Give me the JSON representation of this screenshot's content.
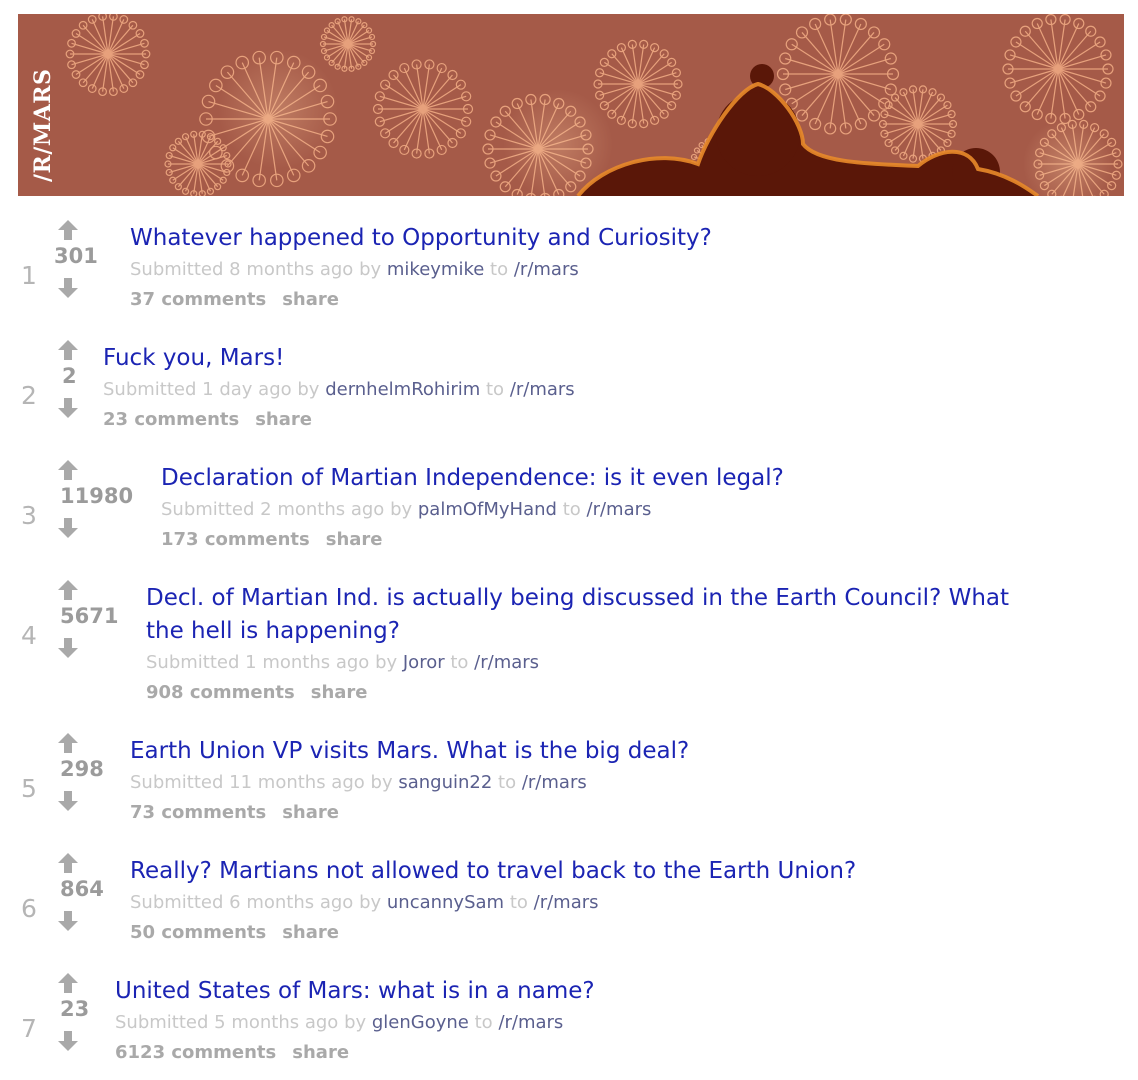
{
  "banner": {
    "title": "/R/MARS",
    "colors": {
      "bg": "#a55a48",
      "light": "#f3ae86",
      "dark": "#5a1708"
    }
  },
  "colors": {
    "link": "#1b24b3",
    "muted": "#c8c8c8",
    "user": "#5a5f8e",
    "score": "#9b9b9b"
  },
  "posts": [
    {
      "rank": "1",
      "score": "301",
      "title": "Whatever happened to Opportunity and Curiosity?",
      "submitted": "Submitted",
      "time": "8 months ago",
      "by": "by",
      "author": "mikeymike",
      "to": "to",
      "subreddit": "/r/mars",
      "comments": "37 comments",
      "share": "share"
    },
    {
      "rank": "2",
      "score": "2",
      "title": "Fuck you, Mars!",
      "submitted": "Submitted",
      "time": "1 day ago",
      "by": "by",
      "author": "dernhelmRohirim",
      "to": "to",
      "subreddit": "/r/mars",
      "comments": "23 comments",
      "share": "share"
    },
    {
      "rank": "3",
      "score": "11980",
      "title": "Declaration of Martian Independence: is it even legal?",
      "submitted": "Submitted",
      "time": "2 months ago",
      "by": "by",
      "author": "palmOfMyHand",
      "to": "to",
      "subreddit": "/r/mars",
      "comments": "173 comments",
      "share": "share"
    },
    {
      "rank": "4",
      "score": "5671",
      "title": "Decl. of Martian Ind. is actually being discussed in the Earth Council? What the hell is happening?",
      "submitted": "Submitted",
      "time": "1 months ago",
      "by": "by",
      "author": "Joror",
      "to": "to",
      "subreddit": "/r/mars",
      "comments": "908 comments",
      "share": "share"
    },
    {
      "rank": "5",
      "score": "298",
      "title": "Earth Union VP visits Mars. What is the big deal?",
      "submitted": "Submitted",
      "time": "11 months ago",
      "by": "by",
      "author": "sanguin22",
      "to": "to",
      "subreddit": "/r/mars",
      "comments": "73 comments",
      "share": "share"
    },
    {
      "rank": "6",
      "score": "864",
      "title": "Really? Martians not allowed to travel back to the Earth Union?",
      "submitted": "Submitted",
      "time": "6 months ago",
      "by": "by",
      "author": "uncannySam",
      "to": "to",
      "subreddit": "/r/mars",
      "comments": "50 comments",
      "share": "share"
    },
    {
      "rank": "7",
      "score": "23",
      "title": "United States of Mars: what is in a name?",
      "submitted": "Submitted",
      "time": "5 months ago",
      "by": "by",
      "author": "glenGoyne",
      "to": "to",
      "subreddit": "/r/mars",
      "comments": "6123 comments",
      "share": "share"
    }
  ]
}
